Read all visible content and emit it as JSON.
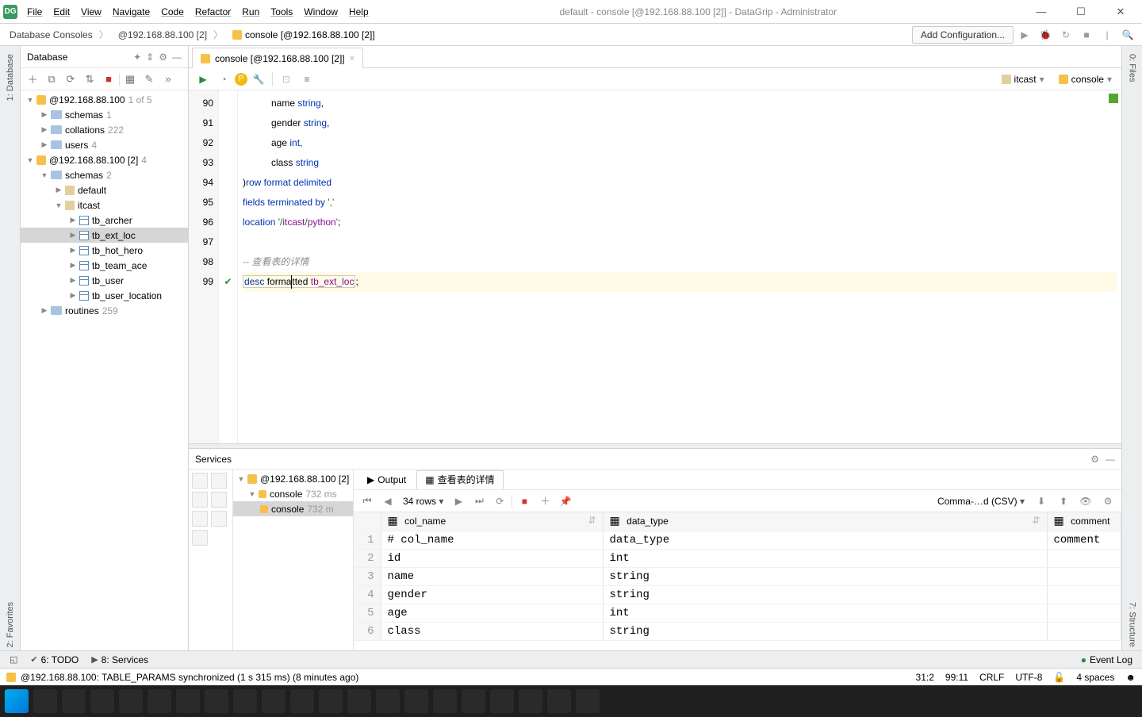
{
  "titlebar": {
    "title": "default - console [@192.168.88.100 [2]] - DataGrip - Administrator"
  },
  "menu": [
    "File",
    "Edit",
    "View",
    "Navigate",
    "Code",
    "Refactor",
    "Run",
    "Tools",
    "Window",
    "Help"
  ],
  "breadcrumbs": {
    "a": "Database Consoles",
    "b": "@192.168.88.100 [2]",
    "c": "console [@192.168.88.100 [2]]"
  },
  "addConfig": "Add Configuration...",
  "dbPanel": {
    "title": "Database",
    "root1": {
      "name": "@192.168.88.100",
      "count": "1 of 5"
    },
    "schemas1": {
      "name": "schemas",
      "count": "1"
    },
    "collations": {
      "name": "collations",
      "count": "222"
    },
    "users": {
      "name": "users",
      "count": "4"
    },
    "root2": {
      "name": "@192.168.88.100 [2]",
      "count": "4"
    },
    "schemas2": {
      "name": "schemas",
      "count": "2"
    },
    "default": {
      "name": "default"
    },
    "itcast": {
      "name": "itcast"
    },
    "tables": [
      "tb_archer",
      "tb_ext_loc",
      "tb_hot_hero",
      "tb_team_ace",
      "tb_user",
      "tb_user_location"
    ],
    "routines": {
      "name": "routines",
      "count": "259"
    }
  },
  "tab": {
    "label": "console [@192.168.88.100 [2]]"
  },
  "schemaSel": "itcast",
  "consoleSel": "console",
  "gutter": [
    "90",
    "91",
    "92",
    "93",
    "94",
    "95",
    "96",
    "97",
    "98",
    "99"
  ],
  "code": {
    "l90a": "name ",
    "l90b": "string",
    "l90c": ",",
    "l91a": "gender ",
    "l91b": "string",
    "l91c": ",",
    "l92a": "age ",
    "l92b": "int",
    "l92c": ",",
    "l93a": "class ",
    "l93b": "string",
    "l94a": ")",
    "l94b": "row format delimited",
    "l95a": "fields terminated by ",
    "l95b": "','",
    "l96a": "location ",
    "l96b": "'/",
    "l96c": "itcast",
    "l96d": "/",
    "l96e": "python",
    "l96f": "'",
    "l96g": ";",
    "l98": "-- 查看表的详情",
    "l99a": "desc",
    "l99b": " forma",
    "l99c": "tted ",
    "l99d": "tb_ext_loc",
    "l99e": ";"
  },
  "services": {
    "title": "Services",
    "rootLabel": "@192.168.88.100 [2]",
    "rootCount": "",
    "c1": "console",
    "c1t": "732 ms",
    "c2": "console",
    "c2t": "732 m",
    "outputTab": "Output",
    "resultsTab": "查看表的详情",
    "rowsLabel": "34 rows",
    "csvLabel": "Comma-…d (CSV)"
  },
  "cols": {
    "c1": "col_name",
    "c2": "data_type",
    "c3": "comment"
  },
  "rows": [
    {
      "n": "1",
      "c1": "# col_name",
      "c2": "data_type",
      "c3": "comment"
    },
    {
      "n": "2",
      "c1": "id",
      "c2": "int",
      "c3": ""
    },
    {
      "n": "3",
      "c1": "name",
      "c2": "string",
      "c3": ""
    },
    {
      "n": "4",
      "c1": "gender",
      "c2": "string",
      "c3": ""
    },
    {
      "n": "5",
      "c1": "age",
      "c2": "int",
      "c3": ""
    },
    {
      "n": "6",
      "c1": "class",
      "c2": "string",
      "c3": ""
    }
  ],
  "bottomTools": {
    "todo": "6: TODO",
    "services": "8: Services",
    "eventLog": "Event Log"
  },
  "status": {
    "msg": "@192.168.88.100: TABLE_PARAMS synchronized (1 s 315 ms) (8 minutes ago)",
    "pos": "31:2",
    "col": "99:11",
    "crlf": "CRLF",
    "enc": "UTF-8",
    "spaces": "4 spaces"
  },
  "side": {
    "database": "1: Database",
    "favorites": "2: Favorites",
    "structure": "7: Structure",
    "files": "0: Files"
  }
}
